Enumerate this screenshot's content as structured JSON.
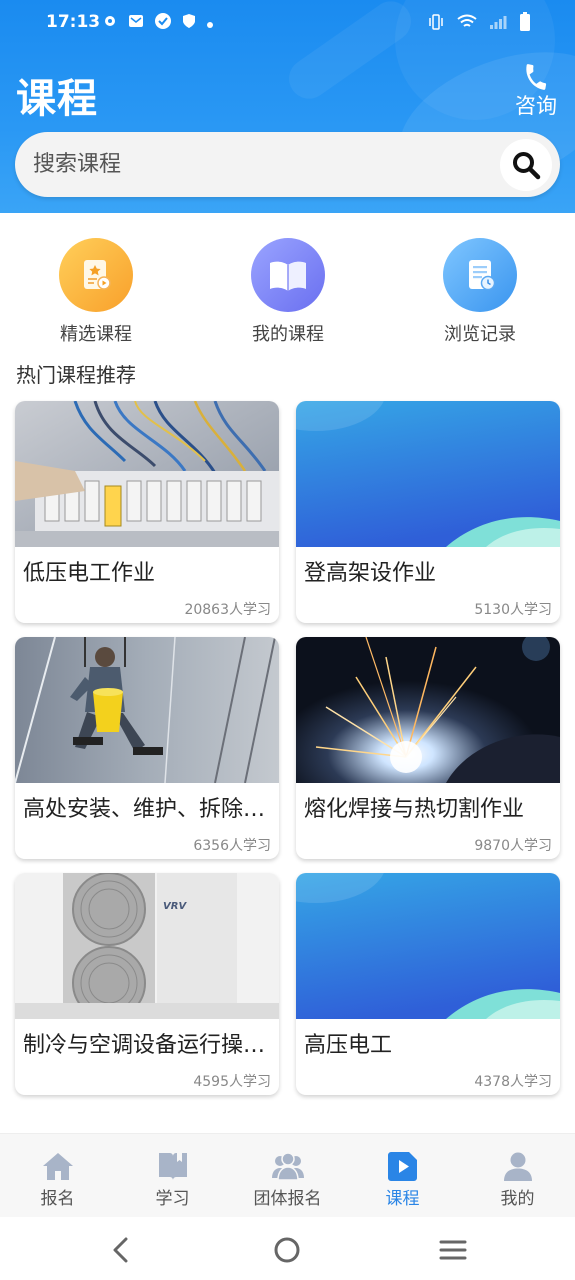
{
  "status_bar": {
    "time": "17:13",
    "left_icons": [
      "gear-icon",
      "mail-icon",
      "check-circle-icon",
      "shield-icon",
      "dot-icon"
    ],
    "right_icons": [
      "vibrate-icon",
      "wifi-icon",
      "signal-icon",
      "battery-icon"
    ]
  },
  "header": {
    "title": "课程",
    "consult_label": "咨询"
  },
  "search": {
    "placeholder": "搜索课程"
  },
  "quick_entries": [
    {
      "label": "精选课程",
      "icon": "featured-course-icon",
      "color": "#f8a02b"
    },
    {
      "label": "我的课程",
      "icon": "book-open-icon",
      "color": "#6a6ff0"
    },
    {
      "label": "浏览记录",
      "icon": "history-doc-icon",
      "color": "#3a95ef"
    }
  ],
  "section_title": "热门课程推荐",
  "courses": [
    {
      "title": "低压电工作业",
      "count": "20863人学习",
      "thumb": "electrical-panel-photo"
    },
    {
      "title": "登高架设作业",
      "count": "5130人学习",
      "thumb": "blue-gradient-placeholder"
    },
    {
      "title": "高处安装、维护、拆除作业",
      "count": "6356人学习",
      "thumb": "window-cleaner-photo"
    },
    {
      "title": "熔化焊接与热切割作业",
      "count": "9870人学习",
      "thumb": "welding-sparks-photo"
    },
    {
      "title": "制冷与空调设备运行操作作业",
      "count": "4595人学习",
      "thumb": "ac-unit-photo"
    },
    {
      "title": "高压电工",
      "count": "4378人学习",
      "thumb": "blue-gradient-placeholder"
    }
  ],
  "bottom_nav": [
    {
      "label": "报名",
      "icon": "home-icon",
      "active": false
    },
    {
      "label": "学习",
      "icon": "book-icon",
      "active": false
    },
    {
      "label": "团体报名",
      "icon": "group-icon",
      "active": false
    },
    {
      "label": "课程",
      "icon": "play-icon",
      "active": true
    },
    {
      "label": "我的",
      "icon": "user-icon",
      "active": false
    }
  ],
  "colors": {
    "header_blue": "#1a8bf0",
    "active_tab": "#2a85e6",
    "inactive_icon": "#a8b4c8"
  }
}
